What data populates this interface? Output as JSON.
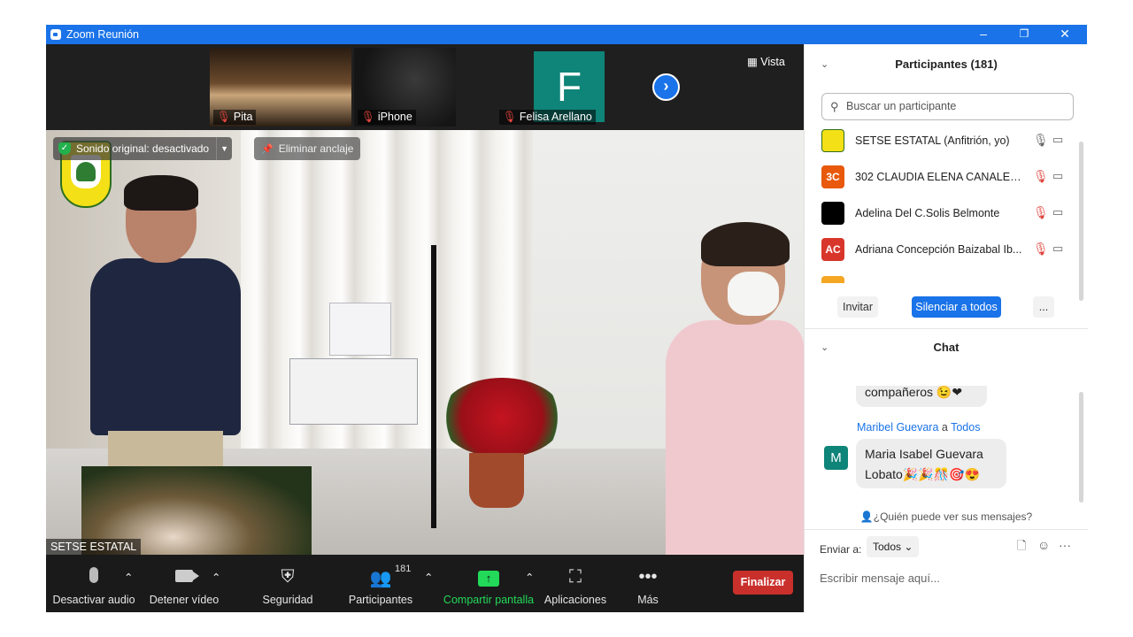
{
  "window": {
    "title": "Zoom Reunión",
    "minimize": "–",
    "restore": "❐",
    "close": "✕"
  },
  "strip": {
    "thumbs": [
      {
        "name": "Pita"
      },
      {
        "name": "iPhone"
      },
      {
        "name": "Felisa Arellano",
        "initial": "F"
      }
    ],
    "next": "›",
    "view_label": "Vista"
  },
  "main_video": {
    "original_sound": "Sonido original: desactivado",
    "unpin": "Eliminar anclaje",
    "speaker_name": "SETSE ESTATAL"
  },
  "toolbar": {
    "items": [
      {
        "label": "Desactivar audio"
      },
      {
        "label": "Detener vídeo"
      },
      {
        "label": "Seguridad"
      },
      {
        "label": "Participantes",
        "count": "181"
      },
      {
        "label": "Compartir pantalla"
      },
      {
        "label": "Aplicaciones"
      },
      {
        "label": "Más"
      }
    ],
    "end_label": "Finalizar"
  },
  "participants": {
    "header": "Participantes (181)",
    "search_placeholder": "Buscar un participante",
    "list": [
      {
        "name": "SETSE ESTATAL (Anfitrión, yo)",
        "avatar": "",
        "muted": false,
        "video_off": false
      },
      {
        "name": "302 CLAUDIA ELENA CANALES ...",
        "avatar": "3C",
        "avatar_color": "#e8590c",
        "muted": true,
        "video_off": false
      },
      {
        "name": "Adelina Del C.Solis Belmonte",
        "avatar": "",
        "avatar_color": "#000000",
        "muted": true,
        "video_off": false
      },
      {
        "name": "Adriana Concepción Baizabal Ib...",
        "avatar": "AC",
        "avatar_color": "#d9362b",
        "muted": true,
        "video_off": true
      }
    ],
    "invite_label": "Invitar",
    "mute_all_label": "Silenciar a todos",
    "more_label": "..."
  },
  "chat": {
    "header": "Chat",
    "prev_message": "compañeros 😉❤",
    "sender": "Maribel Guevara",
    "to_word": "a",
    "recipient": "Todos",
    "sender_initial": "M",
    "message": "Maria Isabel Guevara Lobato🎉🎉🎊🎯😍",
    "who_can_see": "👤¿Quién puede ver sus mensajes?",
    "send_to_label": "Enviar a:",
    "send_to_value": "Todos",
    "input_placeholder": "Escribir mensaje aquí..."
  }
}
